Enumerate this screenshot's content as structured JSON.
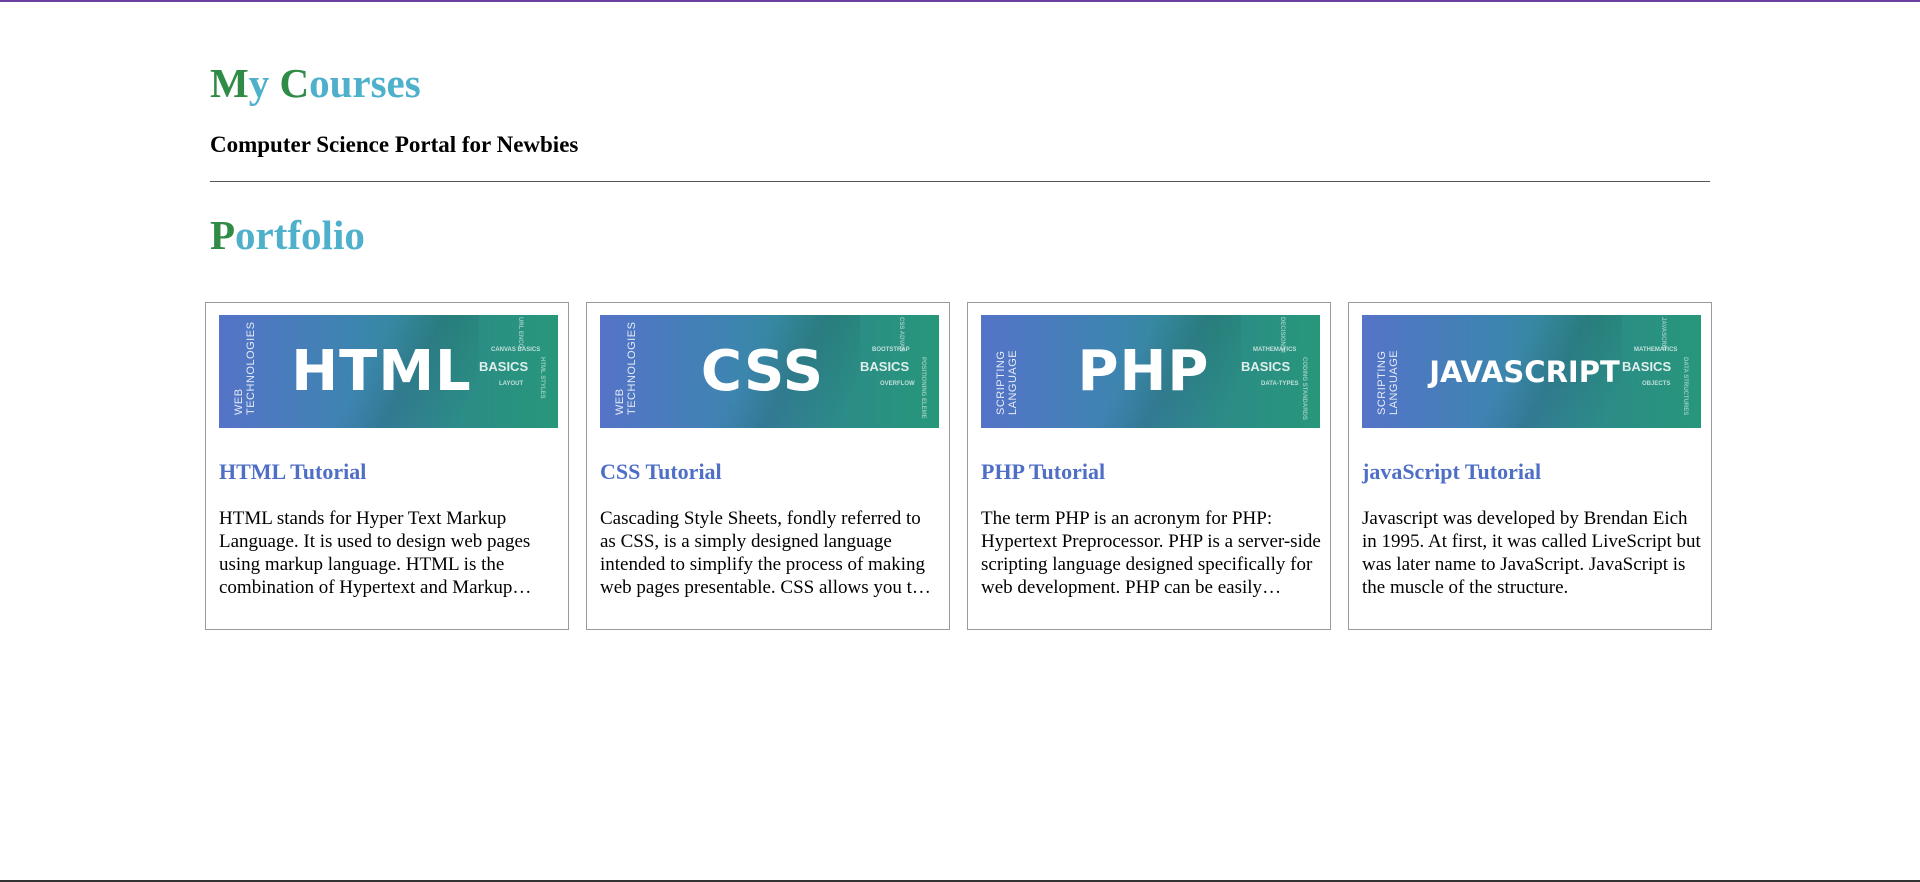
{
  "header": {
    "title_parts": [
      {
        "text": "M",
        "style": "cap"
      },
      {
        "text": "y ",
        "style": "rest"
      },
      {
        "text": "C",
        "style": "cap"
      },
      {
        "text": "ourses",
        "style": "rest"
      }
    ],
    "subtitle": "Computer Science Portal for Newbies"
  },
  "portfolio": {
    "title_cap": "P",
    "title_rest": "ortfolio"
  },
  "colors": {
    "cap_green": "#2f8b46",
    "title_teal": "#4eb0cb",
    "card_title_blue": "#4f6fc7",
    "top_bar_purple": "#6b3fa0"
  },
  "cards": [
    {
      "banner": {
        "side_line1": "WEB",
        "side_line2": "TECHNOLOGIES",
        "big": "HTML",
        "basics": "BASICS",
        "tag1": "CANVAS BASICS",
        "tag2": "LAYOUT",
        "vtag1": "URL ENCO",
        "vtag2": "HTML STYLES"
      },
      "title": "HTML Tutorial",
      "text": "HTML stands for Hyper Text Markup Language. It is used to design web pages using markup language. HTML is the combination of Hypertext and Markup language."
    },
    {
      "banner": {
        "side_line1": "WEB",
        "side_line2": "TECHNOLOGIES",
        "big": "CSS",
        "basics": "BASICS",
        "tag1": "BOOTSTRAP",
        "tag2": "OVERFLOW",
        "vtag1": "CSS ADVAN",
        "vtag2": "POSITIONING ELEME"
      },
      "title": "CSS Tutorial",
      "text": "Cascading Style Sheets, fondly referred to as CSS, is a simply designed language intended to simplify the process of making web pages presentable. CSS allows you to apply styles."
    },
    {
      "banner": {
        "side_line1": "SCRIPTING",
        "side_line2": "LANGUAGE",
        "big": "PHP",
        "basics": "BASICS",
        "tag1": "MATHEMATICS",
        "tag2": "DATA-TYPES",
        "vtag1": "DECISION M",
        "vtag2": "CODING STANDARDS"
      },
      "title": "PHP Tutorial",
      "text": "The term PHP is an acronym for PHP: Hypertext Preprocessor. PHP is a server-side scripting language designed specifically for web development. PHP can be easily embedded."
    },
    {
      "banner": {
        "side_line1": "SCRIPTING",
        "side_line2": "LANGUAGE",
        "big": "JAVASCRIPT",
        "basics": "BASICS",
        "tag1": "MATHEMATICS",
        "tag2": "OBJECTS",
        "vtag1": "JAVASCRIP",
        "vtag2": "DATA STRUCTURES"
      },
      "title": "javaScript Tutorial",
      "text": "Javascript was developed by Brendan Eich in 1995. At first, it was called LiveScript but was later name to JavaScript. JavaScript is the muscle of the structure."
    }
  ]
}
